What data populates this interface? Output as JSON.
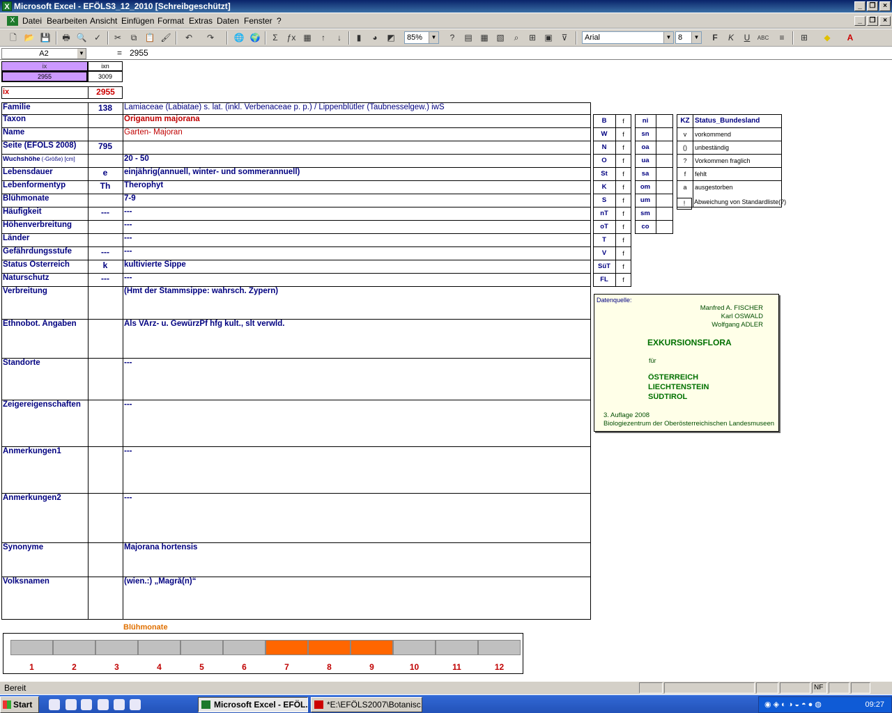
{
  "window": {
    "title": "Microsoft Excel - EFÖLS3_12_2010  [Schreibgeschützt]"
  },
  "menu": [
    "Datei",
    "Bearbeiten",
    "Ansicht",
    "Einfügen",
    "Format",
    "Extras",
    "Daten",
    "Fenster",
    "?"
  ],
  "toolbar": {
    "zoom": "85%",
    "font": "Arial",
    "size": "8"
  },
  "formula": {
    "namebox": "A2",
    "fx": "=",
    "value": "2955"
  },
  "header": {
    "ix_label": "ix",
    "ixn_label": "ixn",
    "ix_value": "2955",
    "ixn_value": "3009",
    "ix_big_label": "ix",
    "ix_big_value": "2955"
  },
  "rows": [
    {
      "label": "Familie",
      "code": "138",
      "text": "Lamiaceae (Labiatae) s. lat. (inkl. Verbenaceae p. p.)  /  Lippenblütler (Taubnesselgew.) iwS"
    },
    {
      "label": "Taxon",
      "code": "",
      "text": "Origanum majorana"
    },
    {
      "label": "Name",
      "code": "",
      "text": "Garten- Majoran"
    },
    {
      "label": "Seite (EFÖLS 2008)",
      "code": "795",
      "text": ""
    },
    {
      "label": "Wuchshöhe",
      "label_small": "(-Größe) [cm]",
      "code": "",
      "text": " 20 - 50"
    },
    {
      "label": "Lebensdauer",
      "code": "e",
      "text": "einjährig(annuell, winter- und sommerannuell)"
    },
    {
      "label": "Lebenformentyp",
      "code": "Th",
      "text": "Therophyt"
    },
    {
      "label": "Blühmonate",
      "code": "",
      "text": " 7-9"
    },
    {
      "label": "Häufigkeit",
      "code": "---",
      "text": " ---"
    },
    {
      "label": "Höhenverbreitung",
      "code": "",
      "text": " ---"
    },
    {
      "label": "Länder",
      "code": "",
      "text": " ---"
    },
    {
      "label": "Gefährdungsstufe",
      "code": "---",
      "text": "  ---"
    },
    {
      "label": "Status Österreich",
      "code": "k",
      "text": "kultivierte Sippe"
    },
    {
      "label": "Naturschutz",
      "code": "---",
      "text": " ---"
    },
    {
      "label": "Verbreitung",
      "code": "",
      "text": "(Hmt der Stammsippe: wahrsch. Zypern)"
    },
    {
      "label": "Ethnobot. Angaben",
      "code": "",
      "text": "Als VArz- u. GewürzPf hfg kult., slt verwld."
    },
    {
      "label": "Standorte",
      "code": "",
      "text": "---"
    },
    {
      "label": "Zeigereigenschaften",
      "code": "",
      "text": "---"
    },
    {
      "label": "Anmerkungen1",
      "code": "",
      "text": "---"
    },
    {
      "label": "Anmerkungen2",
      "code": "",
      "text": "---"
    },
    {
      "label": "Synonyme",
      "code": "",
      "text": "Majorana hortensis"
    },
    {
      "label": "Volksnamen",
      "code": "",
      "text": "(wien.:) „Magrå(n)“"
    }
  ],
  "regions1": [
    [
      "B",
      "f"
    ],
    [
      "W",
      "f"
    ],
    [
      "N",
      "f"
    ],
    [
      "O",
      "f"
    ],
    [
      "St",
      "f"
    ],
    [
      "K",
      "f"
    ],
    [
      "S",
      "f"
    ],
    [
      "nT",
      "f"
    ],
    [
      "oT",
      "f"
    ],
    [
      "T",
      "f"
    ],
    [
      "V",
      "f"
    ],
    [
      "SüT",
      "f"
    ],
    [
      "FL",
      "f"
    ]
  ],
  "regions2": [
    "ni",
    "sn",
    "oa",
    "ua",
    "sa",
    "om",
    "um",
    "sm",
    "co"
  ],
  "legend": {
    "title_kz": "KZ",
    "title": "Status_Bundesland",
    "items": [
      [
        "v",
        "vorkommend"
      ],
      [
        "()",
        "unbeständig"
      ],
      [
        "?",
        "Vorkommen fraglich"
      ],
      [
        "f",
        "fehlt"
      ],
      [
        "a",
        "ausgestorben"
      ],
      [
        "!",
        "Abweichung von Standardliste(?)"
      ]
    ]
  },
  "source": {
    "label": "Datenquelle:",
    "authors": [
      "Manfred A. FISCHER",
      "Karl OSWALD",
      "Wolfgang ADLER"
    ],
    "title": "EXKURSIONSFLORA",
    "fuer": "für",
    "countries": [
      "ÖSTERREICH",
      "LIECHTENSTEIN",
      "SÜDTIROL"
    ],
    "edition": "3. Auflage 2008",
    "publisher": "Biologiezentrum der Oberösterreichischen Landesmuseen"
  },
  "bloom": {
    "title": "Blühmonate",
    "months": [
      "1",
      "2",
      "3",
      "4",
      "5",
      "6",
      "7",
      "8",
      "9",
      "10",
      "11",
      "12"
    ],
    "active": [
      7,
      8,
      9
    ],
    "active_color": "#ff6600"
  },
  "status": {
    "text": "Bereit",
    "nf": "NF"
  },
  "taskbar": {
    "start": "Start",
    "tasks": [
      "Microsoft Excel - EFÖL...",
      "*E:\\EFÖLS2007\\Botanisc..."
    ],
    "clock": "09:27"
  }
}
